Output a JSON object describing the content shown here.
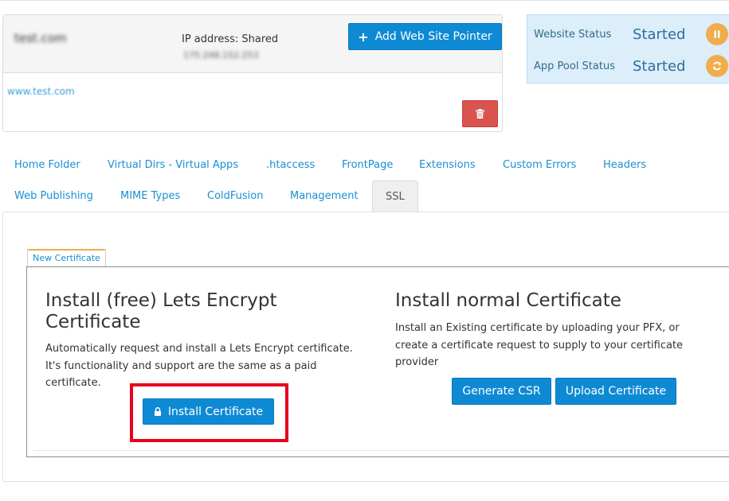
{
  "site": {
    "name": "test.com",
    "ip_label": "IP address: Shared",
    "ip_value": "175.248.152.253",
    "add_pointer_label": "Add Web Site Pointer",
    "www_link": "www.test.com"
  },
  "status": {
    "website_label": "Website Status",
    "website_value": "Started",
    "apppool_label": "App Pool Status",
    "apppool_value": "Started"
  },
  "tabs": [
    {
      "label": "Home Folder"
    },
    {
      "label": "Virtual Dirs - Virtual Apps"
    },
    {
      "label": ".htaccess"
    },
    {
      "label": "FrontPage"
    },
    {
      "label": "Extensions"
    },
    {
      "label": "Custom Errors"
    },
    {
      "label": "Headers"
    },
    {
      "label": "Web Publishing"
    },
    {
      "label": "MIME Types"
    },
    {
      "label": "ColdFusion"
    },
    {
      "label": "Management"
    },
    {
      "label": "SSL"
    }
  ],
  "ssl": {
    "subtab_label": "New Certificate",
    "lets_encrypt": {
      "title": "Install (free) Lets Encrypt Certificate",
      "description": "Automatically request and install a Lets Encrypt certificate. It's functionality and support are the same as a paid certificate.",
      "button_label": "Install Certificate"
    },
    "normal": {
      "title": "Install normal Certificate",
      "description": "Install an Existing certificate by uploading your PFX, or create a certificate request to supply to your certificate provider",
      "generate_csr_label": "Generate CSR",
      "upload_label": "Upload Certificate"
    }
  },
  "colors": {
    "primary": "#0e8ad4",
    "danger": "#d9534f",
    "warning": "#f0ad4e",
    "highlight": "#e8001c",
    "status_bg": "#dbeefa"
  },
  "icons": {
    "add": "plus-icon",
    "delete": "trash-icon",
    "pause": "pause-icon",
    "refresh": "refresh-icon",
    "lock": "lock-icon"
  }
}
